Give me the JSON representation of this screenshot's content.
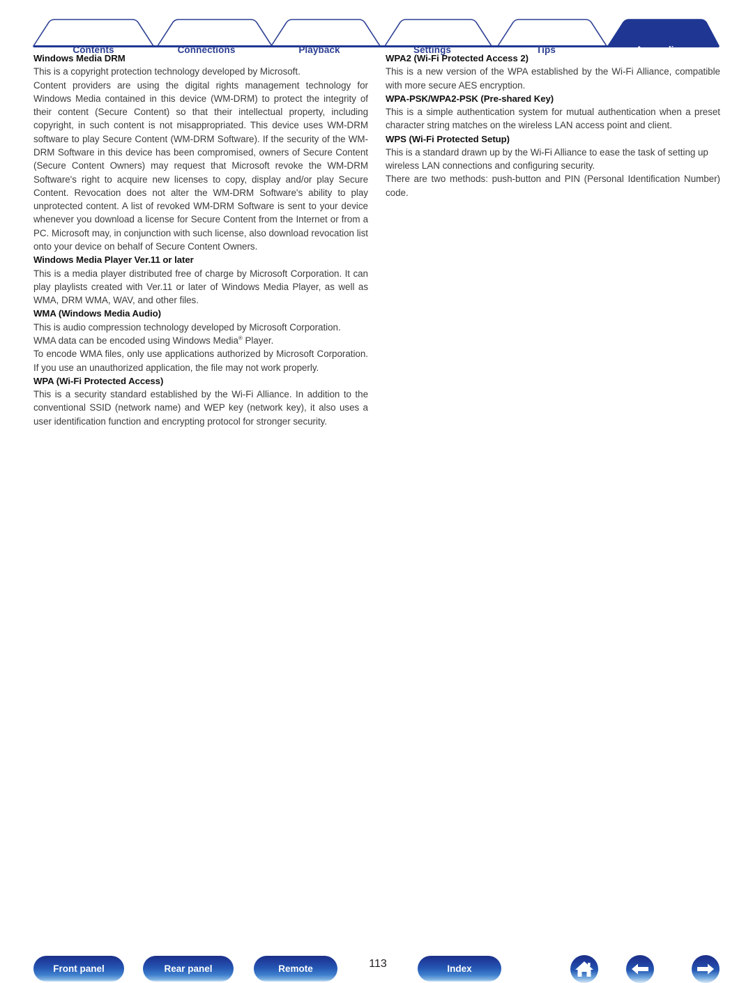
{
  "document": {
    "page_number": "113",
    "brand_navy": "#1f3793",
    "tab_text_color": "#2c3f93",
    "active_tab_text_color": "#ffffff"
  },
  "tabs": [
    {
      "label": "Contents",
      "active": false
    },
    {
      "label": "Connections",
      "active": false
    },
    {
      "label": "Playback",
      "active": false
    },
    {
      "label": "Settings",
      "active": false
    },
    {
      "label": "Tips",
      "active": false
    },
    {
      "label": "Appendix",
      "active": true
    }
  ],
  "left_column": {
    "blocks": [
      {
        "heading": "Windows Media DRM",
        "paragraphs": [
          "This is a copyright protection technology developed by Microsoft.",
          "Content providers are using the digital rights management technology for Windows Media contained in this device (WM-DRM) to protect the integrity of their content (Secure Content) so that their intellectual property, including copyright, in such content is not misappropriated. This device uses WM-DRM software to play Secure Content (WM-DRM Software). If the security of the WM-DRM Software in this device has been compromised, owners of Secure Content (Secure Content Owners) may request that Microsoft revoke the WM-DRM Software's right to acquire new licenses to copy, display and/or play Secure Content. Revocation does not alter the WM-DRM Software's ability to play unprotected content. A list of revoked WM-DRM Software is sent to your device whenever you download a license for Secure Content from the Internet or from a PC. Microsoft may, in conjunction with such license, also download revocation list onto your device on behalf of Secure Content Owners."
        ]
      },
      {
        "heading": "Windows Media Player Ver.11 or later",
        "paragraphs": [
          "This is a media player distributed free of charge by Microsoft Corporation. It can play playlists created with Ver.11 or later of Windows Media Player, as well as WMA, DRM WMA, WAV, and other files."
        ]
      },
      {
        "heading": "WMA (Windows Media Audio)",
        "paragraphs": [
          "This is audio compression technology developed by Microsoft Corporation.",
          "WMA data can be encoded using Windows Media® Player.",
          "To encode WMA files, only use applications authorized by Microsoft Corporation. If you use an unauthorized application, the file may not work properly."
        ]
      },
      {
        "heading": "WPA (Wi-Fi Protected Access)",
        "paragraphs": [
          "This is a security standard established by the Wi-Fi Alliance. In addition to the conventional SSID (network name) and WEP key (network key), it also uses a user identification function and encrypting protocol for stronger security."
        ]
      }
    ]
  },
  "right_column": {
    "blocks": [
      {
        "heading": "WPA2 (Wi-Fi Protected Access 2)",
        "paragraphs": [
          "This is a new version of the WPA established by the Wi-Fi Alliance, compatible with more secure AES encryption."
        ]
      },
      {
        "heading": "WPA-PSK/WPA2-PSK (Pre-shared Key)",
        "paragraphs": [
          "This is a simple authentication system for mutual authentication when a preset character string matches on the wireless LAN access point and client."
        ]
      },
      {
        "heading": "WPS (Wi-Fi Protected Setup)",
        "paragraphs": [
          "This is a standard drawn up by the Wi-Fi Alliance to ease the task of setting up wireless LAN connections and configuring security.",
          "There are two methods: push-button and PIN (Personal Identification Number) code."
        ]
      }
    ]
  },
  "footer": {
    "buttons": [
      {
        "label": "Front panel",
        "name": "front-panel-button"
      },
      {
        "label": "Rear panel",
        "name": "rear-panel-button"
      },
      {
        "label": "Remote",
        "name": "remote-button"
      },
      {
        "label": "Index",
        "name": "index-button"
      }
    ],
    "icons": [
      {
        "name": "home-icon",
        "glyph": "home"
      },
      {
        "name": "back-arrow-icon",
        "glyph": "left"
      },
      {
        "name": "forward-arrow-icon",
        "glyph": "right"
      }
    ]
  }
}
